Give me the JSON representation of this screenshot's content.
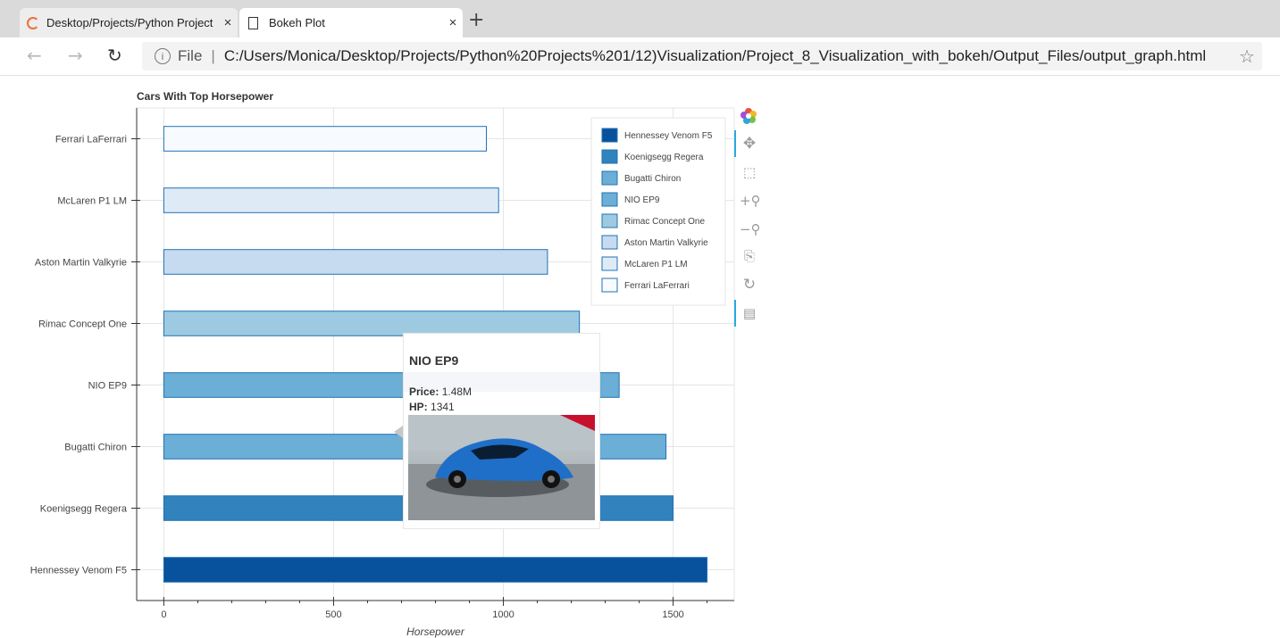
{
  "browser": {
    "tabs": [
      {
        "label": "Desktop/Projects/Python Project",
        "close": "×",
        "active": false
      },
      {
        "label": "Bokeh Plot",
        "close": "×",
        "active": true
      }
    ],
    "new_tab": "+",
    "nav": {
      "back": "←",
      "forward": "→",
      "refresh": "↻"
    },
    "address": {
      "scheme": "File",
      "separator": "|",
      "url": "C:/Users/Monica/Desktop/Projects/Python%20Projects%201/12)Visualization/Project_8_Visualization_with_bokeh/Output_Files/output_graph.html"
    },
    "favorite_icon": "☆"
  },
  "tooltip": {
    "name": "NIO EP9",
    "price_label": "Price:",
    "price_value": "1.48M",
    "hp_label": "HP:",
    "hp_value": "1341",
    "image": "car-photo"
  },
  "chart_data": {
    "type": "bar",
    "orientation": "horizontal",
    "title": "Cars With Top Horsepower",
    "xlabel": "Horsepower",
    "ylabel": "",
    "xlim": [
      -80,
      1680
    ],
    "xticks": [
      0,
      500,
      1000,
      1500
    ],
    "grid": true,
    "legend_position": "top-right",
    "categories": [
      "Hennessey Venom F5",
      "Koenigsegg Regera",
      "Bugatti Chiron",
      "NIO EP9",
      "Rimac Concept One",
      "Aston Martin Valkyrie",
      "McLaren P1 LM",
      "Ferrari LaFerrari"
    ],
    "values": [
      1600,
      1500,
      1479,
      1341,
      1224,
      1130,
      986,
      950
    ],
    "colors": [
      "#08519c",
      "#3182bd",
      "#6baed6",
      "#6baed6",
      "#9ecae1",
      "#c6dbef",
      "#deebf7",
      "#f7fbff"
    ],
    "stroke": "#2171b5",
    "legend": [
      "Hennessey Venom F5",
      "Koenigsegg Regera",
      "Bugatti Chiron",
      "NIO EP9",
      "Rimac Concept One",
      "Aston Martin Valkyrie",
      "McLaren P1 LM",
      "Ferrari LaFerrari"
    ]
  },
  "toolbar": {
    "tools": [
      "bokeh-logo-icon",
      "pan-icon",
      "box-zoom-icon",
      "zoom-in-icon",
      "zoom-out-icon",
      "save-icon",
      "reset-icon",
      "hover-icon"
    ]
  }
}
